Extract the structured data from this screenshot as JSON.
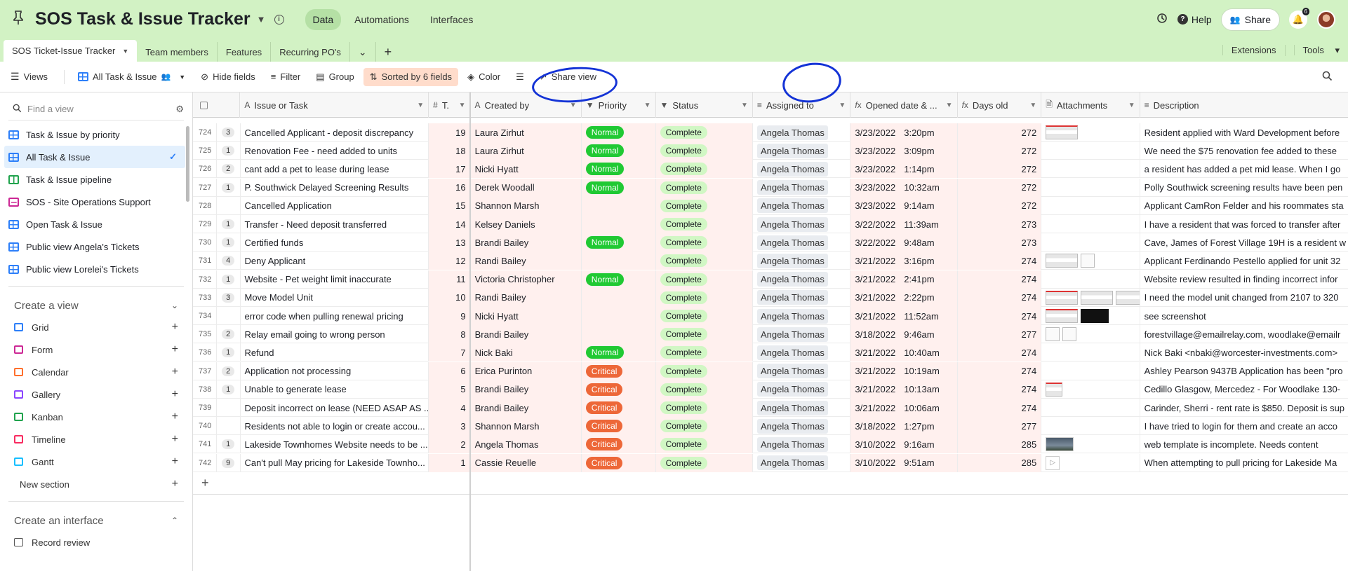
{
  "header": {
    "title": "SOS Task & Issue Tracker",
    "nav": [
      "Data",
      "Automations",
      "Interfaces"
    ],
    "help_label": "Help",
    "share_label": "Share",
    "notification_count": "6"
  },
  "tabs": {
    "active": "SOS Ticket-Issue Tracker",
    "items": [
      "Team members",
      "Features",
      "Recurring PO's"
    ],
    "right": [
      "Extensions",
      "Tools"
    ]
  },
  "viewbar": {
    "views_label": "Views",
    "current_view": "All Task & Issue",
    "hide_fields": "Hide fields",
    "filter": "Filter",
    "group": "Group",
    "sorted": "Sorted by 6 fields",
    "color": "Color",
    "share_view": "Share view"
  },
  "sidebar": {
    "find_placeholder": "Find a view",
    "views": [
      {
        "label": "Task & Issue by priority",
        "type": "grid"
      },
      {
        "label": "All Task & Issue",
        "type": "grid",
        "active": true
      },
      {
        "label": "Task & Issue pipeline",
        "type": "kanban"
      },
      {
        "label": "SOS - Site Operations Support",
        "type": "form"
      },
      {
        "label": "Open Task & Issue",
        "type": "grid"
      },
      {
        "label": "Public view Angela's Tickets",
        "type": "grid"
      },
      {
        "label": "Public view Lorelei's Tickets",
        "type": "grid"
      }
    ],
    "create_view_label": "Create a view",
    "create_items": [
      {
        "label": "Grid",
        "color": "#2d7ff9"
      },
      {
        "label": "Form",
        "color": "#cc2895"
      },
      {
        "label": "Calendar",
        "color": "#ff6f2c"
      },
      {
        "label": "Gallery",
        "color": "#8b46ff"
      },
      {
        "label": "Kanban",
        "color": "#20a34d"
      },
      {
        "label": "Timeline",
        "color": "#f82b60"
      },
      {
        "label": "Gantt",
        "color": "#18bfff"
      }
    ],
    "new_section_label": "New section",
    "create_interface_label": "Create an interface",
    "record_review_label": "Record review"
  },
  "columns": [
    "Issue or Task",
    "T.",
    "Created by",
    "Priority",
    "Status",
    "Assigned to",
    "Opened date & ...",
    "Days old",
    "Attachments",
    "Description"
  ],
  "rows": [
    {
      "num": "724",
      "cnt": "3",
      "issue": "Cancelled Applicant - deposit discrepancy",
      "t": "19",
      "by": "Laura Zirhut",
      "priority": "Normal",
      "status": "Complete",
      "assigned": "Angela Thomas",
      "date": "3/23/2022",
      "time": "3:20pm",
      "days": "272",
      "att": [
        "img-red"
      ],
      "desc": "Resident applied with Ward Development before"
    },
    {
      "num": "725",
      "cnt": "1",
      "issue": "Renovation Fee - need added to units",
      "t": "18",
      "by": "Laura Zirhut",
      "priority": "Normal",
      "status": "Complete",
      "assigned": "Angela Thomas",
      "date": "3/23/2022",
      "time": "3:09pm",
      "days": "272",
      "att": [],
      "desc": "We need the $75 renovation fee added to these"
    },
    {
      "num": "726",
      "cnt": "2",
      "issue": "cant add a pet to lease during lease",
      "t": "17",
      "by": "Nicki Hyatt",
      "priority": "Normal",
      "status": "Complete",
      "assigned": "Angela Thomas",
      "date": "3/23/2022",
      "time": "1:14pm",
      "days": "272",
      "att": [],
      "desc": "a resident has added a pet mid lease. When I go"
    },
    {
      "num": "727",
      "cnt": "1",
      "issue": "P. Southwick Delayed Screening Results",
      "t": "16",
      "by": "Derek Woodall",
      "priority": "Normal",
      "status": "Complete",
      "assigned": "Angela Thomas",
      "date": "3/23/2022",
      "time": "10:32am",
      "days": "272",
      "att": [],
      "desc": "Polly Southwick screening results have been pen"
    },
    {
      "num": "728",
      "cnt": "",
      "issue": "Cancelled Application",
      "t": "15",
      "by": "Shannon Marsh",
      "priority": "",
      "status": "Complete",
      "assigned": "Angela Thomas",
      "date": "3/23/2022",
      "time": "9:14am",
      "days": "272",
      "att": [],
      "desc": "Applicant CamRon Felder and his roommates sta"
    },
    {
      "num": "729",
      "cnt": "1",
      "issue": "Transfer - Need deposit transferred",
      "t": "14",
      "by": "Kelsey Daniels",
      "priority": "",
      "status": "Complete",
      "assigned": "Angela Thomas",
      "date": "3/22/2022",
      "time": "11:39am",
      "days": "273",
      "att": [],
      "desc": "I have a resident that was forced to transfer after"
    },
    {
      "num": "730",
      "cnt": "1",
      "issue": "Certified funds",
      "t": "13",
      "by": "Brandi Bailey",
      "priority": "Normal",
      "status": "Complete",
      "assigned": "Angela Thomas",
      "date": "3/22/2022",
      "time": "9:48am",
      "days": "273",
      "att": [],
      "desc": "Cave, James of Forest Village 19H is a resident w"
    },
    {
      "num": "731",
      "cnt": "4",
      "issue": "Deny Applicant",
      "t": "12",
      "by": "Randi Bailey",
      "priority": "",
      "status": "Complete",
      "assigned": "Angela Thomas",
      "date": "3/21/2022",
      "time": "3:16pm",
      "days": "274",
      "att": [
        "img",
        "doc"
      ],
      "desc": "Applicant Ferdinando Pestello applied for unit 32"
    },
    {
      "num": "732",
      "cnt": "1",
      "issue": "Website - Pet weight limit inaccurate",
      "t": "11",
      "by": "Victoria Christopher",
      "priority": "Normal",
      "status": "Complete",
      "assigned": "Angela Thomas",
      "date": "3/21/2022",
      "time": "2:41pm",
      "days": "274",
      "att": [],
      "desc": "Website review resulted in finding incorrect infor"
    },
    {
      "num": "733",
      "cnt": "3",
      "issue": "Move Model Unit",
      "t": "10",
      "by": "Randi Bailey",
      "priority": "",
      "status": "Complete",
      "assigned": "Angela Thomas",
      "date": "3/21/2022",
      "time": "2:22pm",
      "days": "274",
      "att": [
        "img-red",
        "img",
        "img"
      ],
      "desc": "I need the model unit changed from 2107 to 320"
    },
    {
      "num": "734",
      "cnt": "",
      "issue": "error code when pulling renewal pricing",
      "t": "9",
      "by": "Nicki Hyatt",
      "priority": "",
      "status": "Complete",
      "assigned": "Angela Thomas",
      "date": "3/21/2022",
      "time": "11:52am",
      "days": "274",
      "att": [
        "img-red",
        "dark"
      ],
      "desc": "see screenshot"
    },
    {
      "num": "735",
      "cnt": "2",
      "issue": "Relay email going to wrong person",
      "t": "8",
      "by": "Brandi Bailey",
      "priority": "",
      "status": "Complete",
      "assigned": "Angela Thomas",
      "date": "3/18/2022",
      "time": "9:46am",
      "days": "277",
      "att": [
        "doc",
        "doc"
      ],
      "desc": "forestvillage@emailrelay.com, woodlake@emailr"
    },
    {
      "num": "736",
      "cnt": "1",
      "issue": "Refund",
      "t": "7",
      "by": "Nick Baki",
      "priority": "Normal",
      "status": "Complete",
      "assigned": "Angela Thomas",
      "date": "3/21/2022",
      "time": "10:40am",
      "days": "274",
      "att": [],
      "desc": "Nick Baki <nbaki@worcester-investments.com>"
    },
    {
      "num": "737",
      "cnt": "2",
      "issue": "Application not processing",
      "t": "6",
      "by": "Erica Purinton",
      "priority": "Critical",
      "status": "Complete",
      "assigned": "Angela Thomas",
      "date": "3/21/2022",
      "time": "10:19am",
      "days": "274",
      "att": [],
      "desc": "Ashley Pearson 9437B Application has been \"pro"
    },
    {
      "num": "738",
      "cnt": "1",
      "issue": "Unable to generate lease",
      "t": "5",
      "by": "Brandi Bailey",
      "priority": "Critical",
      "status": "Complete",
      "assigned": "Angela Thomas",
      "date": "3/21/2022",
      "time": "10:13am",
      "days": "274",
      "att": [
        "img-red-small"
      ],
      "desc": "Cedillo Glasgow, Mercedez - For Woodlake 130-"
    },
    {
      "num": "739",
      "cnt": "",
      "issue": "Deposit incorrect on lease (NEED ASAP AS ...",
      "t": "4",
      "by": "Brandi Bailey",
      "priority": "Critical",
      "status": "Complete",
      "assigned": "Angela Thomas",
      "date": "3/21/2022",
      "time": "10:06am",
      "days": "274",
      "att": [],
      "desc": "Carinder, Sherri - rent rate is $850. Deposit is sup"
    },
    {
      "num": "740",
      "cnt": "",
      "issue": "Residents not able to login or create accou...",
      "t": "3",
      "by": "Shannon Marsh",
      "priority": "Critical",
      "status": "Complete",
      "assigned": "Angela Thomas",
      "date": "3/18/2022",
      "time": "1:27pm",
      "days": "277",
      "att": [],
      "desc": "I have tried to login for them and create an acco"
    },
    {
      "num": "741",
      "cnt": "1",
      "issue": "Lakeside Townhomes Website needs to be ...",
      "t": "2",
      "by": "Angela Thomas",
      "priority": "Critical",
      "status": "Complete",
      "assigned": "Angela Thomas",
      "date": "3/10/2022",
      "time": "9:16am",
      "days": "285",
      "att": [
        "photo"
      ],
      "desc": "web template is incomplete. Needs content"
    },
    {
      "num": "742",
      "cnt": "9",
      "issue": "Can't pull May pricing for Lakeside Townho...",
      "t": "1",
      "by": "Cassie Reuelle",
      "priority": "Critical",
      "status": "Complete",
      "assigned": "Angela Thomas",
      "date": "3/10/2022",
      "time": "9:51am",
      "days": "285",
      "att": [
        "play"
      ],
      "desc": "When attempting to pull pricing for Lakeside Ma"
    }
  ],
  "colors": {
    "header_bg": "#d2f2c4",
    "accent": "#2d7ff9",
    "normal": "#20c933",
    "critical": "#ed6738",
    "complete": "#d1f7c4",
    "annotation": "#1433d6"
  }
}
